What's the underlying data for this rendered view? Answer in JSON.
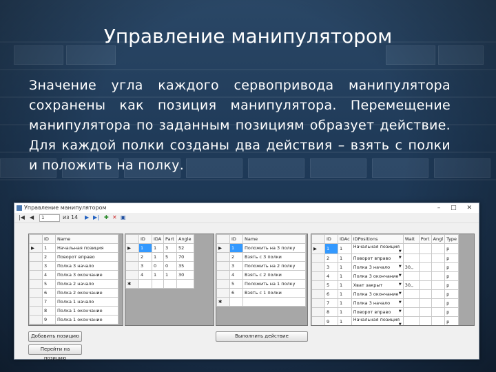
{
  "slide": {
    "title": "Управление манипулятором",
    "body": "Значение угла каждого сервопривода манипулятора сохранены как позиция манипулятора. Перемещение манипулятора по заданным позициям образует действие. Для каждой полки созданы два действия – взять с полки и положить на полку."
  },
  "window": {
    "title": "Управление манипулятором",
    "controls": "– □ ✕",
    "toolbar": {
      "position": "1",
      "of_count": "из 14"
    }
  },
  "grid1": {
    "headers": [
      "ID",
      "Name"
    ],
    "rows": [
      [
        "1",
        "Начальная позиция"
      ],
      [
        "2",
        "Поворот вправо"
      ],
      [
        "3",
        "Полка 3 начало"
      ],
      [
        "4",
        "Полка 3 окончание"
      ],
      [
        "5",
        "Полка 2 начало"
      ],
      [
        "6",
        "Полка 2 окончание"
      ],
      [
        "7",
        "Полка 1 начало"
      ],
      [
        "8",
        "Полка 1 окончание"
      ],
      [
        "9",
        "Полка 1 окончание"
      ]
    ]
  },
  "grid2": {
    "headers": [
      "ID",
      "IDA",
      "Part",
      "Angle"
    ],
    "rows": [
      [
        "1",
        "1",
        "3",
        "52"
      ],
      [
        "2",
        "1",
        "5",
        "70"
      ],
      [
        "3",
        "0",
        "0",
        "35"
      ],
      [
        "4",
        "1",
        "1",
        "30"
      ]
    ]
  },
  "grid3": {
    "headers": [
      "ID",
      "Name"
    ],
    "rows": [
      [
        "1",
        "Положить на 3 полку"
      ],
      [
        "2",
        "Взять с 3 полки"
      ],
      [
        "3",
        "Положить на 2 полку"
      ],
      [
        "4",
        "Взять с 2 полки"
      ],
      [
        "5",
        "Положить на 1 полку"
      ],
      [
        "6",
        "Взять с 1 полки"
      ]
    ]
  },
  "grid4": {
    "headers": [
      "ID",
      "IDAc",
      "IDPositions",
      "Wait",
      "Port",
      "Angl",
      "Type"
    ],
    "rows": [
      [
        "1",
        "1",
        "Начальная позиция",
        "",
        "",
        "",
        "p"
      ],
      [
        "2",
        "1",
        "Поворот вправо",
        "",
        "",
        "",
        "p"
      ],
      [
        "3",
        "1",
        "Полка 3 начало",
        "30,,",
        "",
        "",
        "p"
      ],
      [
        "4",
        "1",
        "Полка 3 окончание",
        "",
        "",
        "",
        "p"
      ],
      [
        "5",
        "1",
        "Хват закрыт",
        "30,,",
        "",
        "",
        "p"
      ],
      [
        "6",
        "1",
        "Полка 3 окончание",
        "",
        "",
        "",
        "p"
      ],
      [
        "7",
        "1",
        "Полка 3 начало",
        "",
        "",
        "",
        "p"
      ],
      [
        "8",
        "1",
        "Поворот вправо",
        "",
        "",
        "",
        "p"
      ],
      [
        "9",
        "1",
        "Начальная позиция",
        "",
        "",
        "",
        "p"
      ]
    ]
  },
  "buttons": {
    "add_position": "Добавить позицию",
    "move_to_position": "Перейти на позицию",
    "execute_action": "Выполнить действие"
  },
  "colors": {
    "selection": "#3399ff",
    "background": "#1f3a58"
  }
}
